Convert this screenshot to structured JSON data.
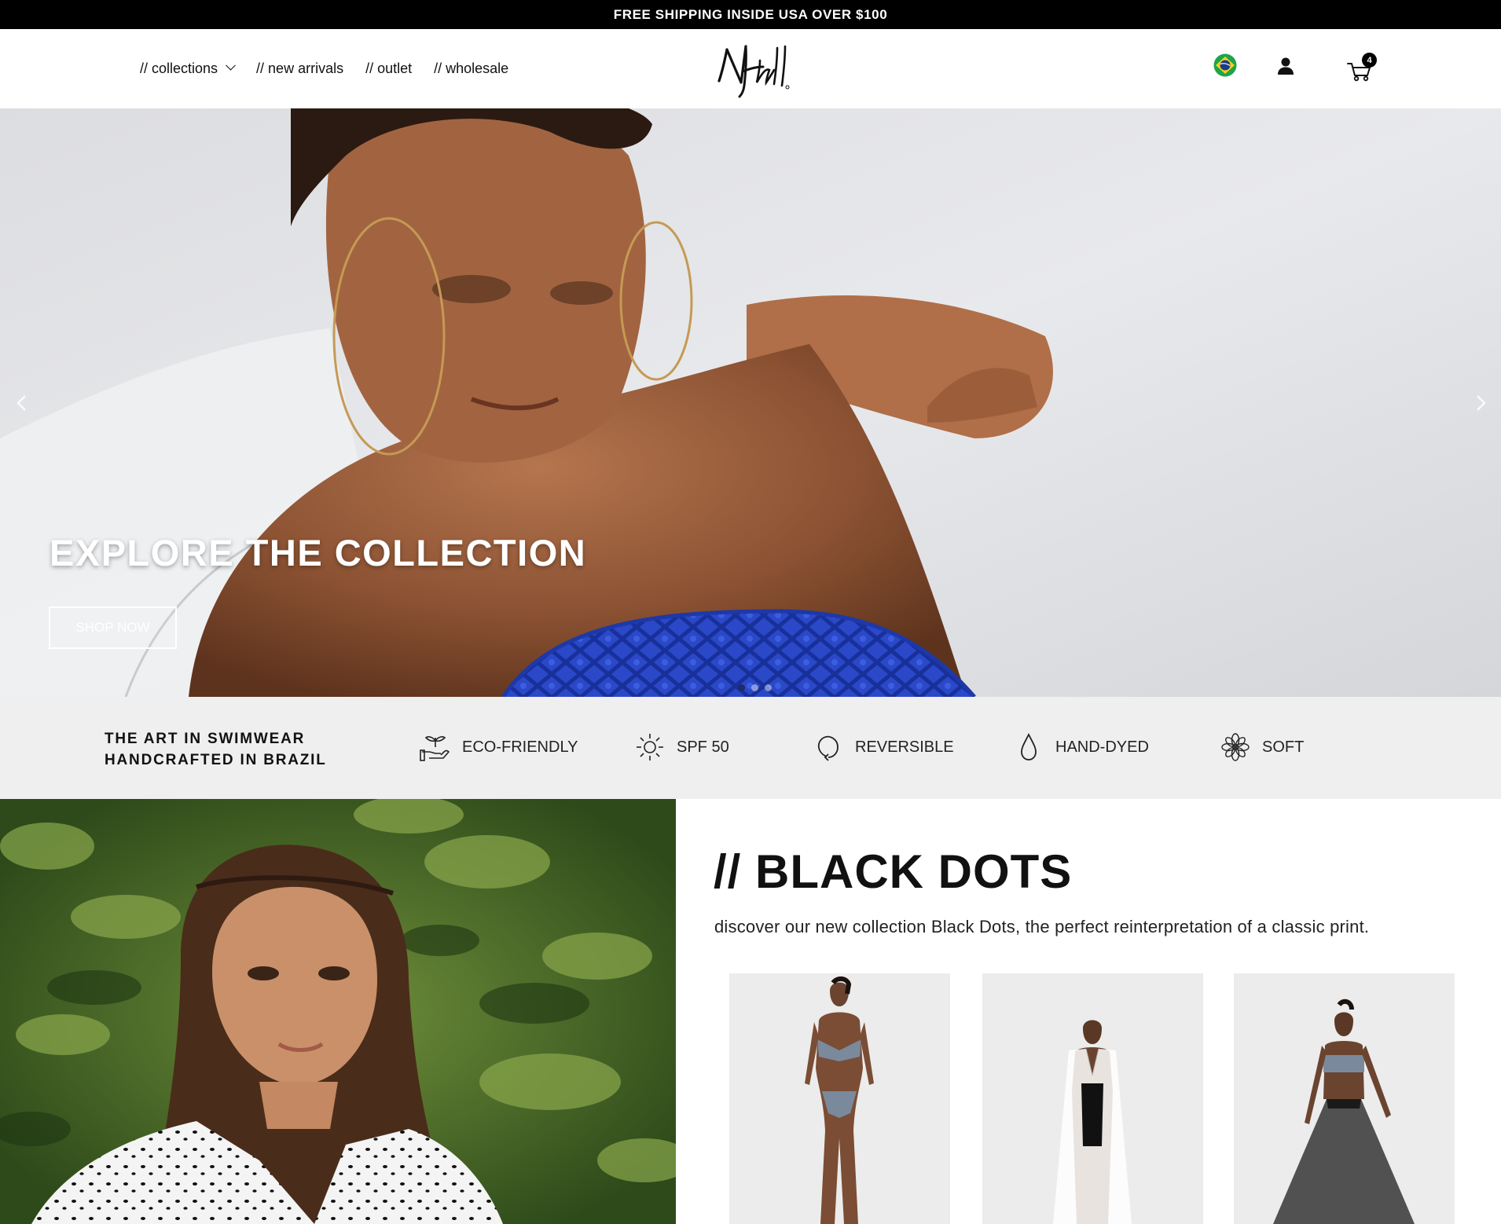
{
  "announcement": {
    "text": "FREE SHIPPING INSIDE USA OVER $100"
  },
  "header": {
    "nav": [
      {
        "label": "// collections",
        "has_dropdown": true
      },
      {
        "label": "// new arrivals"
      },
      {
        "label": "// outlet"
      },
      {
        "label": "// wholesale"
      }
    ],
    "logo_alt": "NHall",
    "cart_count": "4",
    "icons": [
      "brazil-flag-icon",
      "user-icon",
      "cart-icon",
      "chevron-down-icon"
    ]
  },
  "hero": {
    "title": "EXPLORE THE COLLECTION",
    "cta": "SHOP NOW",
    "slides": 3,
    "active_slide": 1,
    "icons": [
      "chevron-left-icon",
      "chevron-right-icon"
    ]
  },
  "features": {
    "tagline_line1": "THE ART IN SWIMWEAR",
    "tagline_line2": "HANDCRAFTED IN BRAZIL",
    "items": [
      {
        "label": "ECO-FRIENDLY",
        "icon": "plant-hand-icon"
      },
      {
        "label": "SPF 50",
        "icon": "sun-icon"
      },
      {
        "label": "REVERSIBLE",
        "icon": "rotate-arrow-icon"
      },
      {
        "label": "HAND-DYED",
        "icon": "drop-icon"
      },
      {
        "label": "SOFT",
        "icon": "flower-icon"
      }
    ]
  },
  "collection": {
    "title": "// BLACK DOTS",
    "description": "discover our new collection Black Dots, the perfect reinterpretation of a classic print."
  },
  "colors": {
    "announcement_bg": "#000000",
    "features_bg": "#efefef",
    "hero_swimwear": "#2a48c8",
    "active_dot": "#1e2a6b"
  }
}
